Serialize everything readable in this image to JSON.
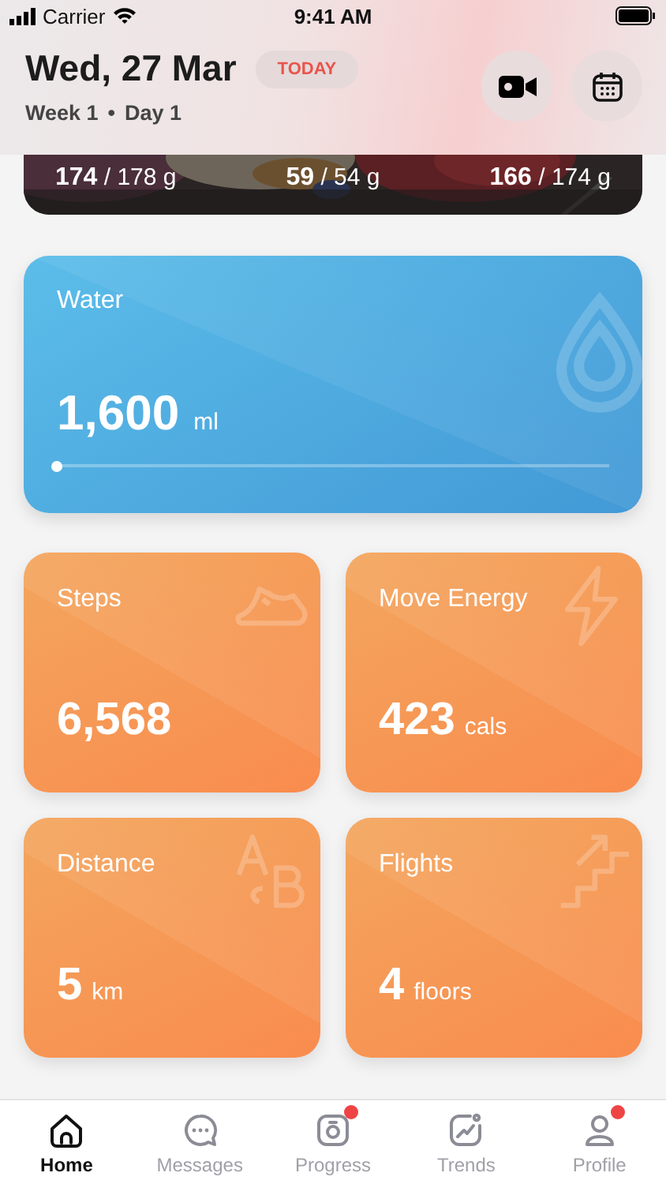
{
  "status_bar": {
    "carrier": "Carrier",
    "time": "9:41 AM"
  },
  "header": {
    "date": "Wed, 27 Mar",
    "badge": "TODAY",
    "week": "Week 1",
    "day": "Day 1",
    "separator": "•"
  },
  "macros": [
    {
      "value": "174",
      "target": "/ 178 g"
    },
    {
      "value": "59",
      "target": "/ 54 g"
    },
    {
      "value": "166",
      "target": "/ 174 g"
    }
  ],
  "water": {
    "label": "Water",
    "value": "1,600",
    "unit": "ml",
    "level": 0
  },
  "stats": [
    {
      "label": "Steps",
      "value": "6,568"
    },
    {
      "label": "Move Energy",
      "value": "423",
      "unit": "cals"
    },
    {
      "label": "Distance",
      "value": "5",
      "unit": "km"
    },
    {
      "label": "Flights",
      "value": "4",
      "unit": "floors"
    }
  ],
  "tabs": [
    {
      "label": "Home",
      "selected": true,
      "notification": false
    },
    {
      "label": "Messages",
      "selected": false,
      "notification": false
    },
    {
      "label": "Progress",
      "selected": false,
      "notification": true
    },
    {
      "label": "Trends",
      "selected": false,
      "notification": false
    },
    {
      "label": "Profile",
      "selected": false,
      "notification": true
    }
  ]
}
